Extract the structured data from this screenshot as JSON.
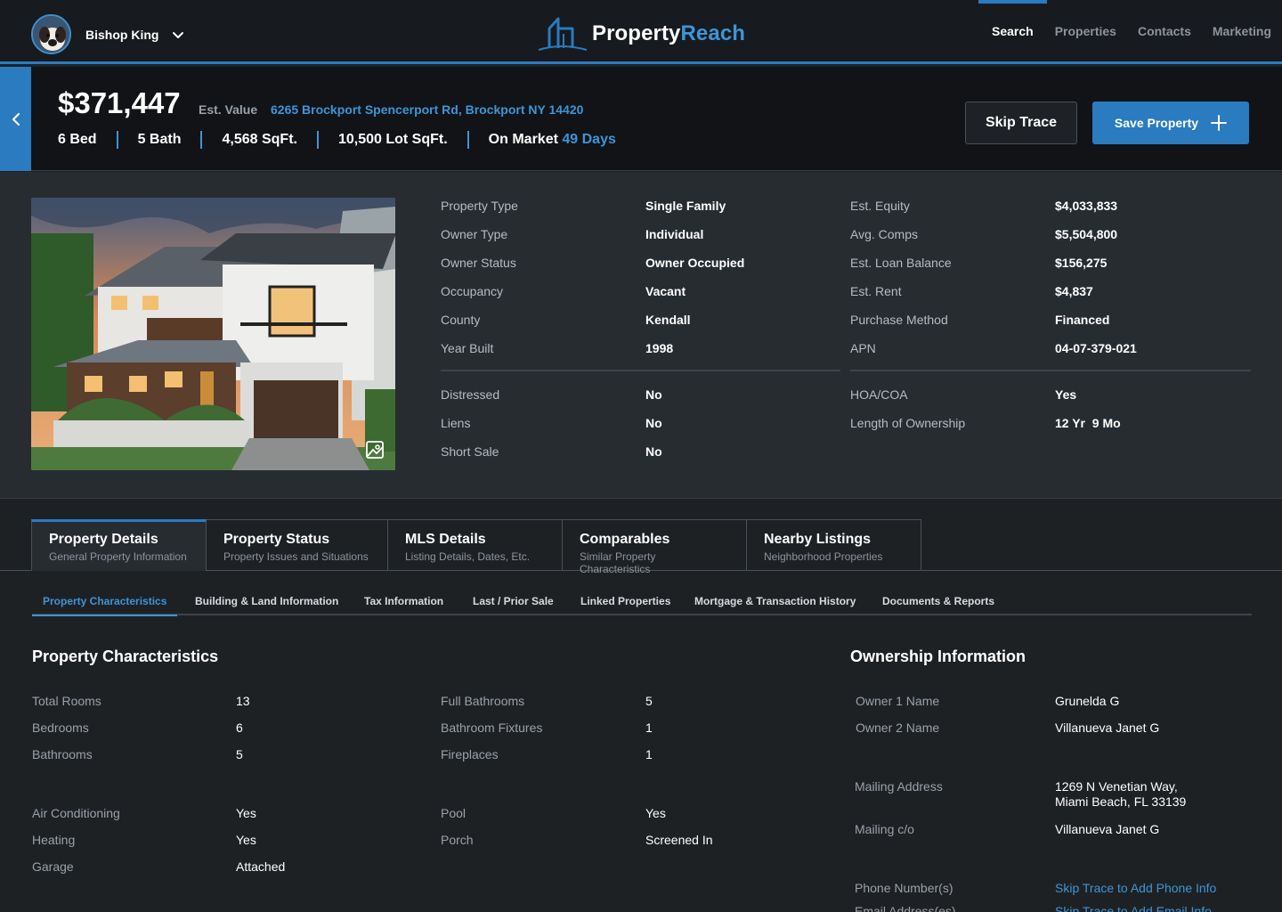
{
  "user": {
    "name": "Bishop King"
  },
  "brand": {
    "part1": "Property",
    "part2": "Reach"
  },
  "nav": [
    {
      "label": "Search",
      "active": true
    },
    {
      "label": "Properties"
    },
    {
      "label": "Contacts"
    },
    {
      "label": "Marketing"
    }
  ],
  "header": {
    "price": "$371,447",
    "est_label": "Est. Value",
    "address": "6265 Brockport Spencerport Rd, Brockport NY 14420",
    "facts": [
      "6 Bed",
      "5 Bath",
      "4,568 SqFt.",
      "10,500 Lot SqFt."
    ],
    "market_label": "On Market",
    "market_days": "49 Days",
    "skip_label": "Skip Trace",
    "save_label": "Save Property"
  },
  "summary": {
    "col1": [
      {
        "label": "Property Type",
        "value": "Single Family"
      },
      {
        "label": "Owner Type",
        "value": "Individual"
      },
      {
        "label": "Owner Status",
        "value": "Owner Occupied"
      },
      {
        "label": "Occupancy",
        "value": "Vacant"
      },
      {
        "label": "County",
        "value": "Kendall"
      },
      {
        "label": "Year Built",
        "value": "1998"
      }
    ],
    "col1_lower": [
      {
        "label": "Distressed",
        "value": "No"
      },
      {
        "label": "Liens",
        "value": "No"
      },
      {
        "label": "Short Sale",
        "value": "No"
      }
    ],
    "col2": [
      {
        "label": "Est. Equity",
        "value": "$4,033,833"
      },
      {
        "label": "Avg. Comps",
        "value": "$5,504,800"
      },
      {
        "label": "Est. Loan Balance",
        "value": "$156,275"
      },
      {
        "label": "Est. Rent",
        "value": "$4,837"
      },
      {
        "label": "Purchase Method",
        "value": "Financed"
      },
      {
        "label": "APN",
        "value": "04-07-379-021"
      }
    ],
    "col2_lower": [
      {
        "label": "HOA/COA",
        "value": "Yes"
      },
      {
        "label": "Length of Ownership",
        "value": "12 Yr  9 Mo"
      }
    ]
  },
  "tabs": [
    {
      "title": "Property Details",
      "sub": "General Property Information",
      "active": true
    },
    {
      "title": "Property Status",
      "sub": "Property Issues and Situations"
    },
    {
      "title": "MLS Details",
      "sub": "Listing Details, Dates, Etc."
    },
    {
      "title": "Comparables",
      "sub": "Similar Property Characteristics"
    },
    {
      "title": "Nearby Listings",
      "sub": "Neighborhood Properties"
    }
  ],
  "subtabs": [
    {
      "label": "Property Characteristics",
      "active": true
    },
    {
      "label": "Building & Land Information"
    },
    {
      "label": "Tax Information"
    },
    {
      "label": "Last / Prior Sale"
    },
    {
      "label": "Linked Properties"
    },
    {
      "label": "Mortgage & Transaction History"
    },
    {
      "label": "Documents & Reports"
    }
  ],
  "characteristics": {
    "title": "Property Characteristics",
    "group_a": [
      {
        "label": "Total Rooms",
        "value": "13"
      },
      {
        "label": "Bedrooms",
        "value": "6"
      },
      {
        "label": "Bathrooms",
        "value": "5"
      }
    ],
    "group_b": [
      {
        "label": "Full Bathrooms",
        "value": "5"
      },
      {
        "label": "Bathroom Fixtures",
        "value": "1"
      },
      {
        "label": "Fireplaces",
        "value": "1"
      }
    ],
    "group_c": [
      {
        "label": "Air Conditioning",
        "value": "Yes"
      },
      {
        "label": "Heating",
        "value": "Yes"
      },
      {
        "label": "Garage",
        "value": "Attached"
      }
    ],
    "group_d": [
      {
        "label": "Pool",
        "value": "Yes"
      },
      {
        "label": "Porch",
        "value": "Screened In"
      }
    ]
  },
  "ownership": {
    "title": "Ownership Information",
    "owner1_label": "Owner 1 Name",
    "owner1": "Grunelda G",
    "owner2_label": "Owner 2 Name",
    "owner2": "Villanueva Janet G",
    "mailing_label": "Mailing Address",
    "mailing_line1": "1269 N Venetian Way,",
    "mailing_line2": "Miami Beach, FL 33139",
    "co_label": "Mailing c/o",
    "co": "Villanueva Janet G",
    "phone_label": "Phone Number(s)",
    "phone_link": "Skip Trace to Add Phone Info",
    "email_label": "Email Address(es)",
    "email_link": "Skip Trace to Add Email Info"
  }
}
